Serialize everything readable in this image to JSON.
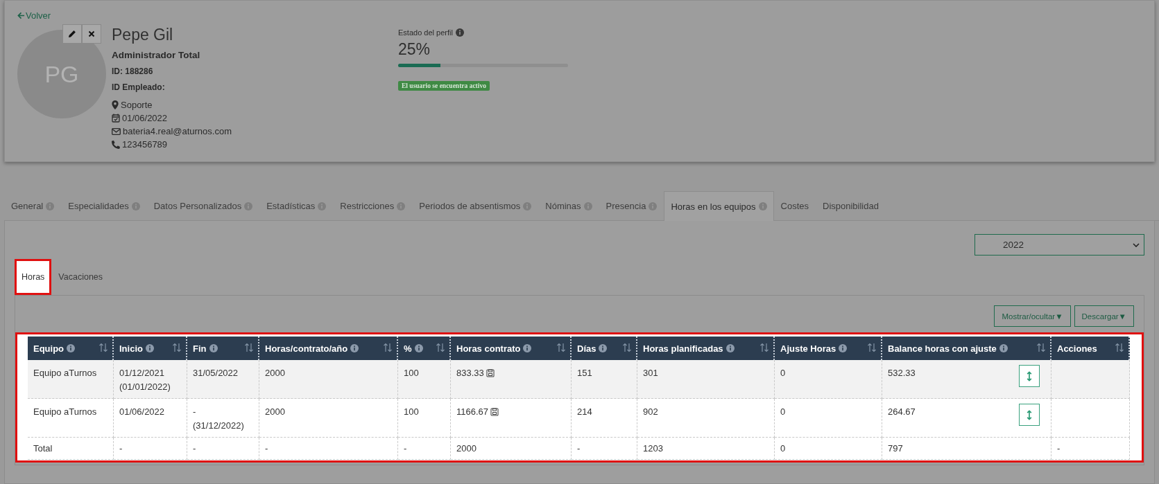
{
  "back_link": "Volver",
  "profile": {
    "initials": "PG",
    "name": "Pepe Gil",
    "role": "Administrador Total",
    "id_line": "ID: 188286",
    "employee_id_line": "ID Empleado:",
    "details": [
      {
        "kind": "location",
        "text": "Soporte"
      },
      {
        "kind": "date",
        "text": "01/06/2022"
      },
      {
        "kind": "email",
        "text": "bateria4.real@aturnos.com"
      },
      {
        "kind": "phone",
        "text": "123456789"
      }
    ]
  },
  "profile_status": {
    "label": "Estado del perfil",
    "percent": "25%",
    "level": 0.25,
    "badge": "El usuario se encuentra activo"
  },
  "tabs": [
    {
      "label": "General",
      "info": true,
      "selected": false
    },
    {
      "label": "Especialidades",
      "info": true,
      "selected": false
    },
    {
      "label": "Datos Personalizados",
      "info": true,
      "selected": false
    },
    {
      "label": "Estadísticas",
      "info": true,
      "selected": false
    },
    {
      "label": "Restricciones",
      "info": true,
      "selected": false
    },
    {
      "label": "Periodos de absentismos",
      "info": true,
      "selected": false
    },
    {
      "label": "Nóminas",
      "info": true,
      "selected": false
    },
    {
      "label": "Presencia",
      "info": true,
      "selected": false
    },
    {
      "label": "Horas en los equipos",
      "info": true,
      "selected": true
    },
    {
      "label": "Costes",
      "info": false,
      "selected": false
    },
    {
      "label": "Disponibilidad",
      "info": false,
      "selected": false
    }
  ],
  "year_select": {
    "value": "2022"
  },
  "subtabs": [
    {
      "label": "Horas",
      "selected": true,
      "highlighted": true
    },
    {
      "label": "Vacaciones",
      "selected": false,
      "highlighted": false
    }
  ],
  "buttons": [
    "Mostrar/ocultar▼",
    "Descargar▼"
  ],
  "table": {
    "highlighted": true,
    "columns": [
      {
        "label": "Equipo",
        "info": true
      },
      {
        "label": "Inicio",
        "info": true
      },
      {
        "label": "Fin",
        "info": true
      },
      {
        "label": "Horas/contrato/año",
        "info": true
      },
      {
        "label": "%",
        "info": true
      },
      {
        "label": "Horas contrato",
        "info": true
      },
      {
        "label": "Días",
        "info": true
      },
      {
        "label": "Horas planificadas",
        "info": true
      },
      {
        "label": "Ajuste Horas",
        "info": true
      },
      {
        "label": "Balance horas con ajuste",
        "info": true
      },
      {
        "label": "Acciones",
        "info": false
      }
    ],
    "rows": [
      {
        "cells": [
          "Equipo aTurnos",
          "01/12/2021\n(01/01/2022)",
          "31/05/2022",
          "2000",
          "100",
          "833.33",
          "151",
          "301",
          "0",
          "532.33",
          ""
        ],
        "contract_icon": true,
        "balance_button": true
      },
      {
        "cells": [
          "Equipo aTurnos",
          "01/06/2022",
          "-\n(31/12/2022)",
          "2000",
          "100",
          "1166.67",
          "214",
          "902",
          "0",
          "264.67",
          ""
        ],
        "contract_icon": true,
        "balance_button": true
      },
      {
        "cells": [
          "Total",
          "-",
          "-",
          "-",
          "-",
          "2000",
          "-",
          "1203",
          "0",
          "797",
          "-"
        ],
        "contract_icon": false,
        "balance_button": false
      }
    ]
  }
}
